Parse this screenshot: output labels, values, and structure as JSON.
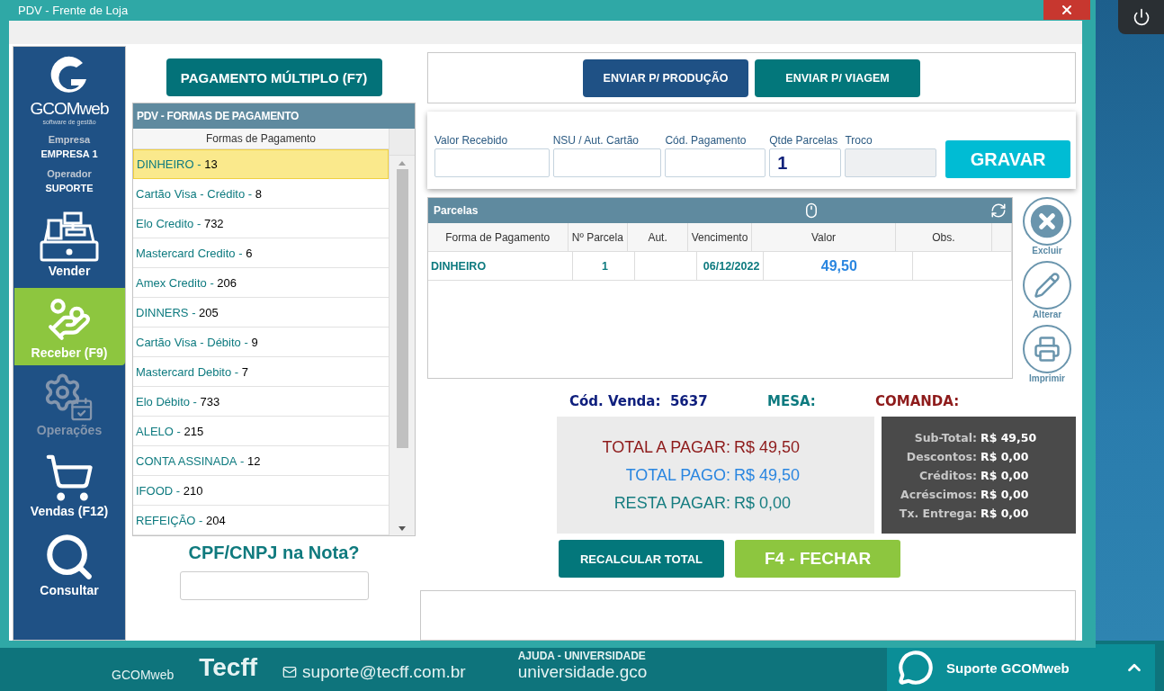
{
  "window": {
    "title": "PDV - Frente de Loja"
  },
  "sidebar": {
    "brand": "GCOMweb",
    "tagline": "software de gestão",
    "company_label": "Empresa",
    "company": "EMPRESA 1",
    "operator_label": "Operador",
    "operator": "SUPORTE",
    "items": [
      {
        "label": "Vender",
        "kind": "register",
        "selected": false,
        "disabled": false
      },
      {
        "label": "Receber (F9)",
        "kind": "receive",
        "selected": true,
        "disabled": false
      },
      {
        "label": "Operações",
        "kind": "operations",
        "selected": false,
        "disabled": true
      },
      {
        "label": "Vendas (F12)",
        "kind": "cart",
        "selected": false,
        "disabled": false
      },
      {
        "label": "Consultar",
        "kind": "search",
        "selected": false,
        "disabled": false
      }
    ]
  },
  "multi_payment_button": "PAGAMENTO MÚLTIPLO (F7)",
  "payment_methods": {
    "title": "PDV - FORMAS DE PAGAMENTO",
    "column": "Formas de Pagamento",
    "separator": "-",
    "rows": [
      {
        "name": "DINHEIRO",
        "code": "13",
        "selected": true
      },
      {
        "name": "Cartão Visa - Crédito",
        "code": "8",
        "selected": false
      },
      {
        "name": "Elo Credito",
        "code": "732",
        "selected": false
      },
      {
        "name": "Mastercard Credito",
        "code": "6",
        "selected": false
      },
      {
        "name": "Amex Credito",
        "code": "206",
        "selected": false
      },
      {
        "name": "DINNERS",
        "code": "205",
        "selected": false
      },
      {
        "name": "Cartão Visa - Débito",
        "code": "9",
        "selected": false
      },
      {
        "name": "Mastercard Debito",
        "code": "7",
        "selected": false
      },
      {
        "name": "Elo Débito",
        "code": "733",
        "selected": false
      },
      {
        "name": "ALELO",
        "code": "215",
        "selected": false
      },
      {
        "name": "CONTA ASSINADA",
        "code": "12",
        "selected": false
      },
      {
        "name": "IFOOD",
        "code": "210",
        "selected": false
      },
      {
        "name": "REFEIÇÃO",
        "code": "204",
        "selected": false
      }
    ]
  },
  "cpf": {
    "title": "CPF/CNPJ na Nota?"
  },
  "send_buttons": [
    {
      "label": "ENVIAR P/ PRODUÇÃO",
      "kind": "production"
    },
    {
      "label": "ENVIAR P/ VIAGEM",
      "kind": "travel"
    }
  ],
  "form": {
    "fields": [
      {
        "label": "Valor Recebido",
        "disabled": false
      },
      {
        "label": "NSU / Aut. Cartão",
        "disabled": false
      },
      {
        "label": "Cód. Pagamento",
        "disabled": false
      },
      {
        "label": "Qtde Parcelas",
        "value": "1",
        "disabled": false
      },
      {
        "label": "Troco",
        "disabled": true
      }
    ],
    "save_button": "GRAVAR"
  },
  "installments": {
    "title": "Parcelas",
    "columns": [
      {
        "label": "Forma de Pagamento",
        "kind": "name"
      },
      {
        "label": "Nº Parcela",
        "kind": "number"
      },
      {
        "label": "Aut.",
        "kind": "plain"
      },
      {
        "label": "Vencimento",
        "kind": "date"
      },
      {
        "label": "Valor",
        "kind": "money"
      },
      {
        "label": "Obs.",
        "kind": "plain"
      }
    ],
    "rows": [
      {
        "cells": [
          "DINHEIRO",
          "1",
          "",
          "06/12/2022",
          "49,50",
          ""
        ]
      }
    ]
  },
  "actions": [
    {
      "label": "Excluir",
      "kind": "delete"
    },
    {
      "label": "Alterar",
      "kind": "edit"
    },
    {
      "label": "Imprimir",
      "kind": "print"
    }
  ],
  "sale": {
    "code_label": "Cód. Venda:",
    "code": "5637",
    "table_label": "MESA:",
    "order_label": "COMANDA:"
  },
  "totals": [
    {
      "label": "TOTAL A PAGAR:",
      "value": "R$ 49,50",
      "kind": "due"
    },
    {
      "label": "TOTAL PAGO:",
      "value": "R$ 49,50",
      "kind": "paid"
    },
    {
      "label": "RESTA PAGAR:",
      "value": "R$ 0,00",
      "kind": "remaining"
    }
  ],
  "summary": [
    {
      "label": "Sub-Total:",
      "value": "R$ 49,50"
    },
    {
      "label": "Descontos:",
      "value": "R$ 0,00"
    },
    {
      "label": "Créditos:",
      "value": "R$ 0,00"
    },
    {
      "label": "Acréscimos:",
      "value": "R$ 0,00"
    },
    {
      "label": "Tx. Entrega:",
      "value": "R$ 0,00"
    }
  ],
  "bottom_buttons": [
    {
      "label": "RECALCULAR TOTAL",
      "kind": "recalc"
    },
    {
      "label": "F4 - FECHAR",
      "kind": "close"
    }
  ],
  "footer": {
    "brand": "GCOMweb",
    "partner": "Tecff",
    "email": "suporte@tecff.com.br",
    "help": "AJUDA - UNIVERSIDADE",
    "help_site": "universidade.gco"
  },
  "support_widget": {
    "label": "Suporte GCOMweb"
  }
}
